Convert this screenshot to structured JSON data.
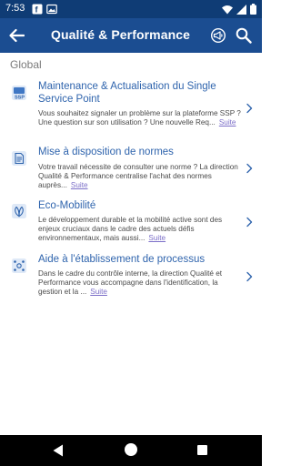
{
  "status": {
    "time": "7:53",
    "icons": [
      "notification-f-icon",
      "image-icon",
      "wifi-icon",
      "signal-icon",
      "battery-icon"
    ]
  },
  "header": {
    "title": "Qualité & Performance",
    "back_icon": "arrow-back-icon",
    "actions": [
      "megaphone-icon",
      "search-icon"
    ]
  },
  "section": {
    "label": "Global"
  },
  "items": [
    {
      "title": "Maintenance & Actualisation du Single Service Point",
      "description": "Vous souhaitez signaler un problème sur la plateforme SSP ? Une question sur son utilisation ? Une nouvelle Req...",
      "link": "Suite",
      "icon": "ssp-icon"
    },
    {
      "title": "Mise à disposition de normes",
      "description": "Votre travail nécessite de consulter une norme ? La direction Qualité & Performance centralise l'achat des normes auprès...",
      "link": "Suite",
      "icon": "document-icon"
    },
    {
      "title": "Eco-Mobilité",
      "description": "Le développement durable et la mobilité active sont des enjeux cruciaux dans le cadre des actuels défis environnementaux, mais aussi...",
      "link": "Suite",
      "icon": "leaf-icon"
    },
    {
      "title": "Aide à l'établissement de processus",
      "description": "Dans le cadre du contrôle interne, la direction Qualité et Performance vous accompagne dans l'identification, la gestion et la ...",
      "link": "Suite",
      "icon": "process-icon"
    }
  ],
  "colors": {
    "status_bar": "#0f3c75",
    "app_bar": "#1b4d91",
    "title_blue": "#2f64ad",
    "link_purple": "#7c6fc8"
  }
}
